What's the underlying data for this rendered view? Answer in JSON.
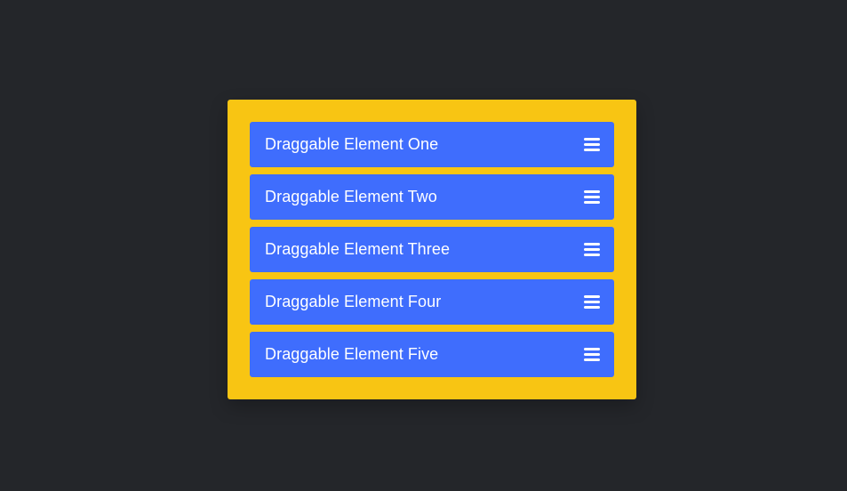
{
  "colors": {
    "background": "#24262a",
    "panel": "#f8c513",
    "item": "#3f6dfd",
    "text": "#ffffff"
  },
  "list": {
    "items": [
      {
        "label": "Draggable Element One",
        "icon": "drag-handle-icon"
      },
      {
        "label": "Draggable Element Two",
        "icon": "drag-handle-icon"
      },
      {
        "label": "Draggable Element Three",
        "icon": "drag-handle-icon"
      },
      {
        "label": "Draggable Element Four",
        "icon": "drag-handle-icon"
      },
      {
        "label": "Draggable Element Five",
        "icon": "drag-handle-icon"
      }
    ]
  }
}
